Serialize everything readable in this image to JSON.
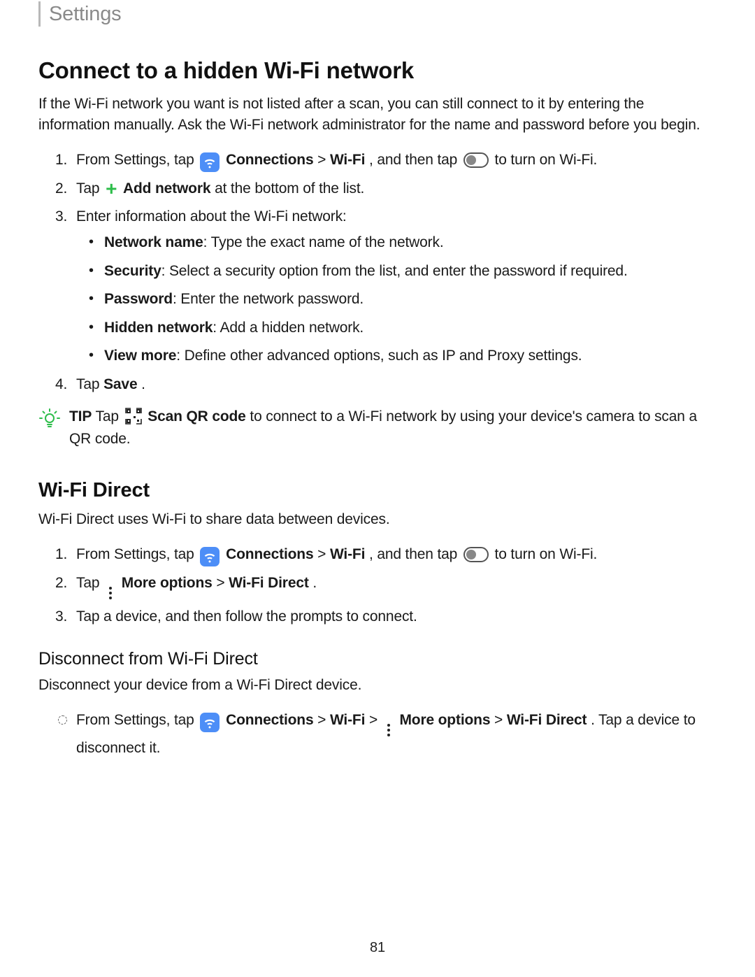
{
  "header": {
    "section": "Settings"
  },
  "h1": "Connect to a hidden Wi-Fi network",
  "intro": "If the Wi-Fi network you want is not listed after a scan, you can still connect to it by entering the information manually. Ask the Wi-Fi network administrator for the name and password before you begin.",
  "steps": [
    {
      "num": "1.",
      "pre": "From Settings, tap ",
      "bold1": "Connections",
      "sep1": " > ",
      "bold2": "Wi-Fi",
      "mid": ", and then tap ",
      "post": " to turn on Wi-Fi."
    },
    {
      "num": "2.",
      "pre": "Tap ",
      "bold1": "Add network",
      "post": " at the bottom of the list."
    },
    {
      "num": "3.",
      "text": "Enter information about the Wi-Fi network:",
      "sub": [
        {
          "bold": "Network name",
          "rest": ": Type the exact name of the network."
        },
        {
          "bold": "Security",
          "rest": ": Select a security option from the list, and enter the password if required."
        },
        {
          "bold": "Password",
          "rest": ": Enter the network password."
        },
        {
          "bold": "Hidden network",
          "rest": ": Add a hidden network."
        },
        {
          "bold": "View more",
          "rest": ": Define other advanced options, such as IP and Proxy settings."
        }
      ]
    },
    {
      "num": "4.",
      "pre": "Tap ",
      "bold1": "Save",
      "post": "."
    }
  ],
  "tip": {
    "label": "TIP",
    "pre": "  Tap ",
    "bold": "Scan QR code",
    "post": " to connect to a Wi-Fi network by using your device's camera to scan a QR code."
  },
  "h2": "Wi-Fi Direct",
  "direct_intro": "Wi-Fi Direct uses Wi-Fi to share data between devices.",
  "steps2": [
    {
      "num": "1.",
      "pre": "From Settings, tap ",
      "bold1": "Connections",
      "sep1": " > ",
      "bold2": "Wi-Fi",
      "mid": ", and then tap ",
      "post": " to turn on Wi-Fi."
    },
    {
      "num": "2.",
      "pre": "Tap ",
      "bold1": "More options",
      "sep1": " > ",
      "bold2": "Wi-Fi Direct",
      "post": "."
    },
    {
      "num": "3.",
      "text": "Tap a device, and then follow the prompts to connect."
    }
  ],
  "h3": "Disconnect from Wi-Fi Direct",
  "disc_intro": "Disconnect your device from a Wi-Fi Direct device.",
  "steps3": [
    {
      "pre": "From Settings, tap ",
      "bold1": "Connections",
      "sep1": " > ",
      "bold2": "Wi-Fi",
      "sep2": " > ",
      "bold3": "More options",
      "sep3": " > ",
      "bold4": "Wi-Fi Direct",
      "post": ". Tap a device to disconnect it."
    }
  ],
  "page_number": "81"
}
